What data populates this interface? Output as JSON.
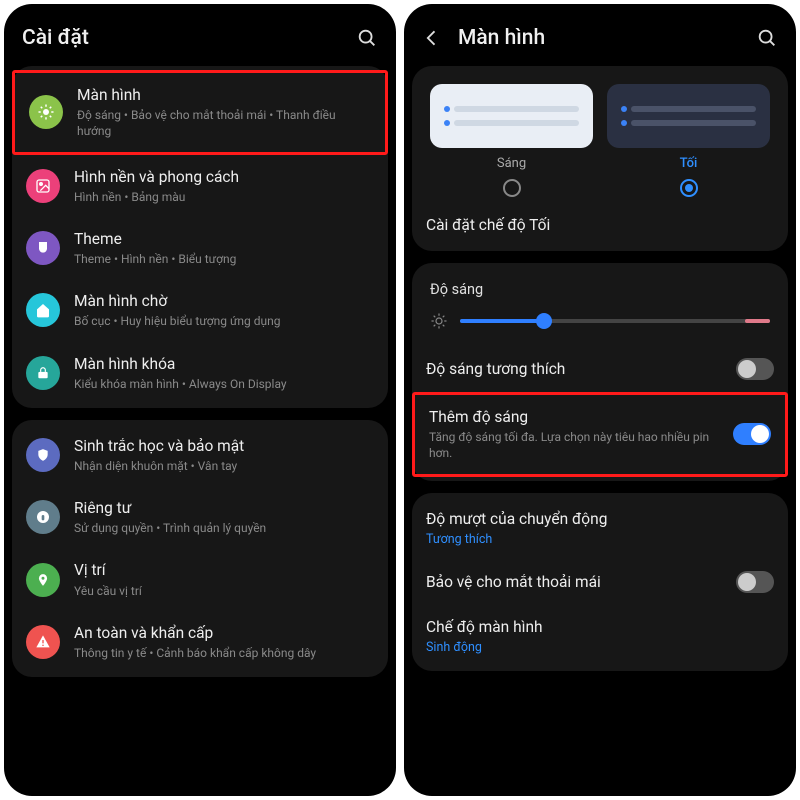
{
  "left": {
    "header_title": "Cài đặt",
    "groups": [
      [
        {
          "icon_bg": "#8bc34a",
          "glyph": "brightness",
          "title": "Màn hình",
          "sub": "Độ sáng • Bảo vệ cho mắt thoải mái • Thanh điều hướng",
          "hl": true
        },
        {
          "icon_bg": "#ec407a",
          "glyph": "image",
          "title": "Hình nền và phong cách",
          "sub": "Hình nền • Bảng màu"
        },
        {
          "icon_bg": "#7e57c2",
          "glyph": "brush",
          "title": "Theme",
          "sub": "Theme • Hình nền • Biểu tượng"
        },
        {
          "icon_bg": "#26c6da",
          "glyph": "home",
          "title": "Màn hình chờ",
          "sub": "Bố cục • Huy hiệu biểu tượng ứng dụng"
        },
        {
          "icon_bg": "#26a69a",
          "glyph": "lock",
          "title": "Màn hình khóa",
          "sub": "Kiểu khóa màn hình • Always On Display"
        }
      ],
      [
        {
          "icon_bg": "#5c6bc0",
          "glyph": "shield",
          "title": "Sinh trắc học và bảo mật",
          "sub": "Nhận diện khuôn mặt • Vân tay"
        },
        {
          "icon_bg": "#607d8b",
          "glyph": "privacy",
          "title": "Riêng tư",
          "sub": "Sử dụng quyền • Trình quản lý quyền"
        },
        {
          "icon_bg": "#4caf50",
          "glyph": "pin",
          "title": "Vị trí",
          "sub": "Yêu cầu vị trí"
        },
        {
          "icon_bg": "#ef5350",
          "glyph": "sos",
          "title": "An toàn và khẩn cấp",
          "sub": "Thông tin y tế • Cảnh báo khẩn cấp không dây"
        }
      ]
    ]
  },
  "right": {
    "header_title": "Màn hình",
    "theme_light_label": "Sáng",
    "theme_dark_label": "Tối",
    "dark_settings_label": "Cài đặt chế độ Tối",
    "brightness_label": "Độ sáng",
    "brightness_pct": 27,
    "adaptive_label": "Độ sáng tương thích",
    "adaptive_on": false,
    "extra_label": "Thêm độ sáng",
    "extra_sub": "Tăng độ sáng tối đa. Lựa chọn này tiêu hao nhiều pin hơn.",
    "extra_on": true,
    "motion_label": "Độ mượt của chuyển động",
    "motion_value": "Tương thích",
    "eye_label": "Bảo vệ cho mắt thoải mái",
    "eye_on": false,
    "mode_label": "Chế độ màn hình",
    "mode_value": "Sinh động"
  }
}
